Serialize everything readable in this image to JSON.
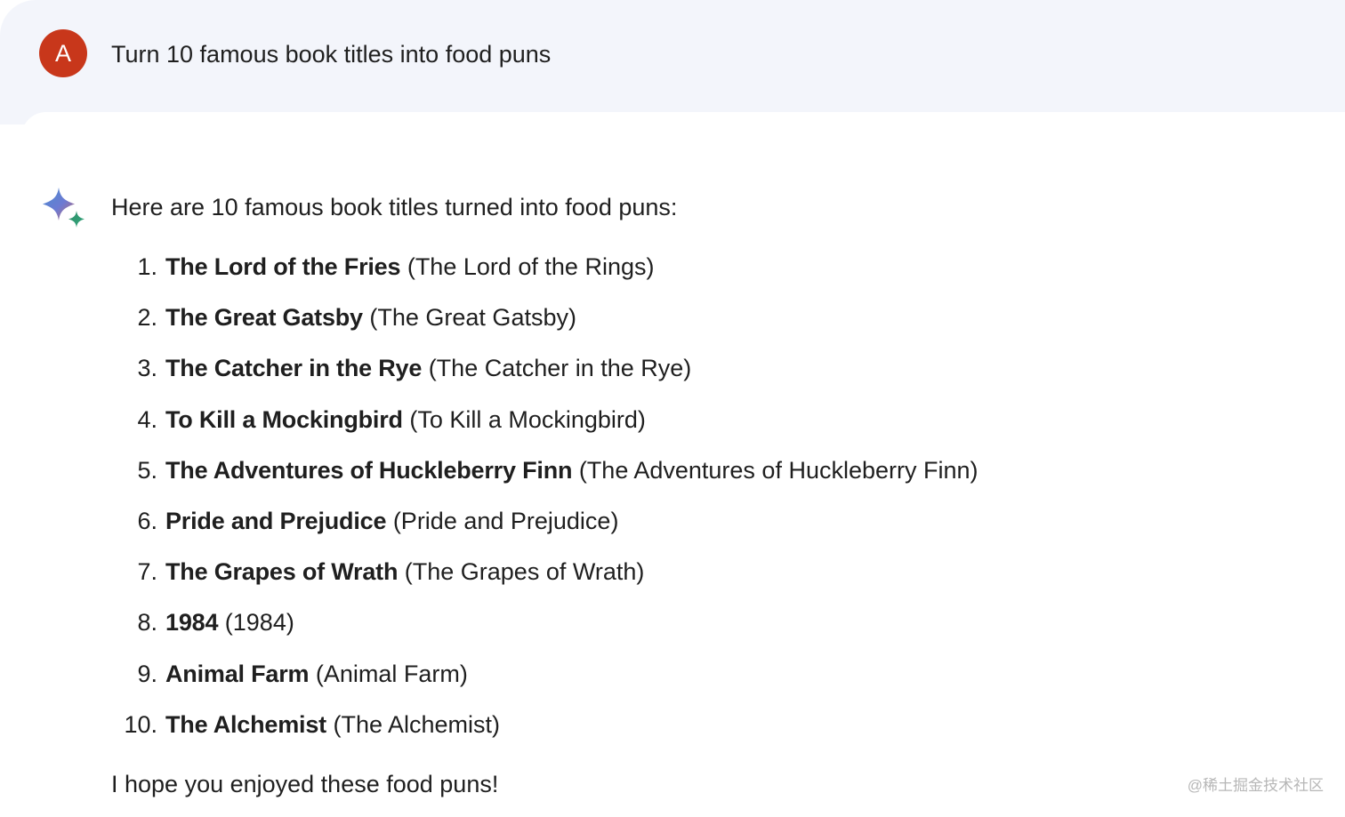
{
  "user_message": {
    "avatar_letter": "A",
    "avatar_color": "#c8371b",
    "text": "Turn 10 famous book titles into food puns"
  },
  "response": {
    "icon": "gemini-sparkle-icon",
    "intro": "Here are 10 famous book titles turned into food puns:",
    "items": [
      {
        "number": "1.",
        "pun": "The Lord of the Fries",
        "original": "(The Lord of the Rings)"
      },
      {
        "number": "2.",
        "pun": "The Great Gatsby",
        "original": "(The Great Gatsby)"
      },
      {
        "number": "3.",
        "pun": "The Catcher in the Rye",
        "original": "(The Catcher in the Rye)"
      },
      {
        "number": "4.",
        "pun": "To Kill a Mockingbird",
        "original": "(To Kill a Mockingbird)"
      },
      {
        "number": "5.",
        "pun": "The Adventures of Huckleberry Finn",
        "original": "(The Adventures of Huckleberry Finn)"
      },
      {
        "number": "6.",
        "pun": "Pride and Prejudice",
        "original": "(Pride and Prejudice)"
      },
      {
        "number": "7.",
        "pun": "The Grapes of Wrath",
        "original": "(The Grapes of Wrath)"
      },
      {
        "number": "8.",
        "pun": "1984",
        "original": "(1984)"
      },
      {
        "number": "9.",
        "pun": "Animal Farm",
        "original": "(Animal Farm)"
      },
      {
        "number": "10.",
        "pun": "The Alchemist",
        "original": "(The Alchemist)"
      }
    ],
    "outro": "I hope you enjoyed these food puns!"
  },
  "watermark": "@稀土掘金技术社区"
}
